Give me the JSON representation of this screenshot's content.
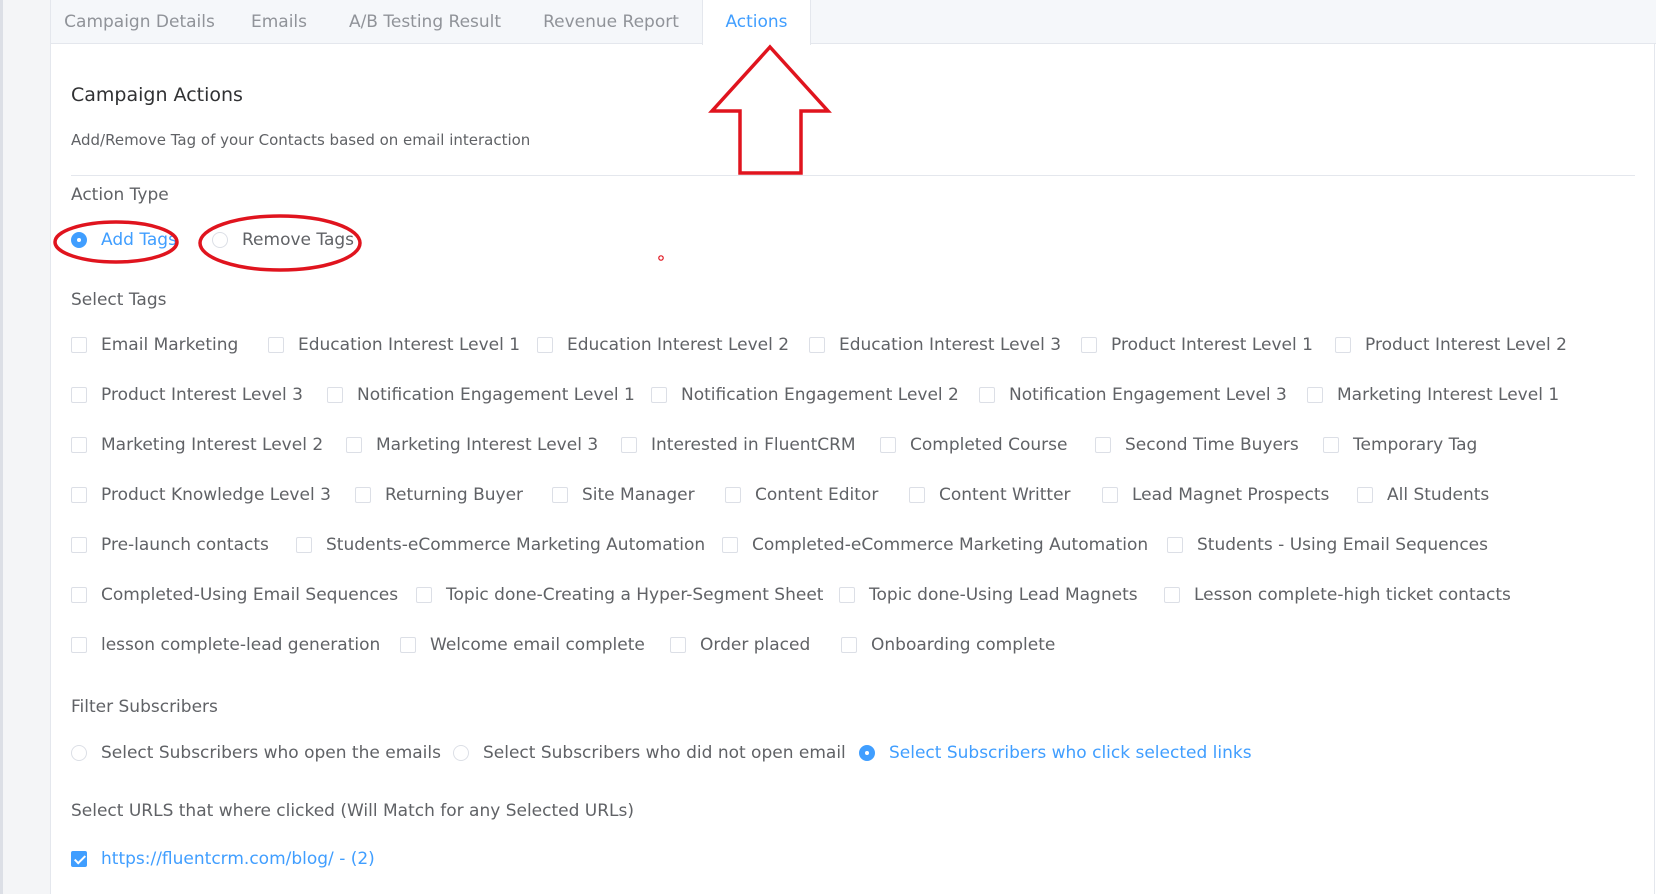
{
  "tabs": [
    {
      "label": "Campaign Details",
      "active": false
    },
    {
      "label": "Emails",
      "active": false
    },
    {
      "label": "A/B Testing Result",
      "active": false
    },
    {
      "label": "Revenue Report",
      "active": false
    },
    {
      "label": "Actions",
      "active": true
    }
  ],
  "campaign_actions": {
    "title": "Campaign Actions",
    "description": "Add/Remove Tag of your Contacts based on email interaction"
  },
  "action_type": {
    "label": "Action Type",
    "options": [
      {
        "label": "Add Tags",
        "selected": true
      },
      {
        "label": "Remove Tags",
        "selected": false
      }
    ]
  },
  "select_tags": {
    "label": "Select Tags",
    "rows": [
      [
        "Email Marketing",
        "Education Interest Level 1",
        "Education Interest Level 2",
        "Education Interest Level 3",
        "Product Interest Level 1",
        "Product Interest Level 2"
      ],
      [
        "Product Interest Level 3",
        "Notification Engagement Level 1",
        "Notification Engagement Level 2",
        "Notification Engagement Level 3",
        "Marketing Interest Level 1"
      ],
      [
        "Marketing Interest Level 2",
        "Marketing Interest Level 3",
        "Interested in FluentCRM",
        "Completed Course",
        "Second Time Buyers",
        "Temporary Tag"
      ],
      [
        "Product Knowledge Level 3",
        "Returning Buyer",
        "Site Manager",
        "Content Editor",
        "Content Writter",
        "Lead Magnet Prospects",
        "All Students"
      ],
      [
        "Pre-launch contacts",
        "Students-eCommerce Marketing Automation",
        "Completed-eCommerce Marketing Automation",
        "Students - Using Email Sequences"
      ],
      [
        "Completed-Using Email Sequences",
        "Topic done-Creating a Hyper-Segment Sheet",
        "Topic done-Using Lead Magnets",
        "Lesson complete-high ticket contacts"
      ],
      [
        "lesson complete-lead generation",
        "Welcome email complete",
        "Order placed",
        "Onboarding complete"
      ]
    ]
  },
  "filter_subscribers": {
    "label": "Filter Subscribers",
    "options": [
      {
        "label": "Select Subscribers who open the emails",
        "selected": false
      },
      {
        "label": "Select Subscribers who did not open email",
        "selected": false
      },
      {
        "label": "Select Subscribers who click selected links",
        "selected": true
      }
    ]
  },
  "select_urls": {
    "label": "Select URLS that where clicked (Will Match for any Selected URLs)",
    "items": [
      {
        "label": "https://fluentcrm.com/blog/ - (2)",
        "checked": true
      }
    ]
  },
  "colors": {
    "primary": "#409eff",
    "annotation_red": "#e0141e",
    "text": "#606266"
  }
}
